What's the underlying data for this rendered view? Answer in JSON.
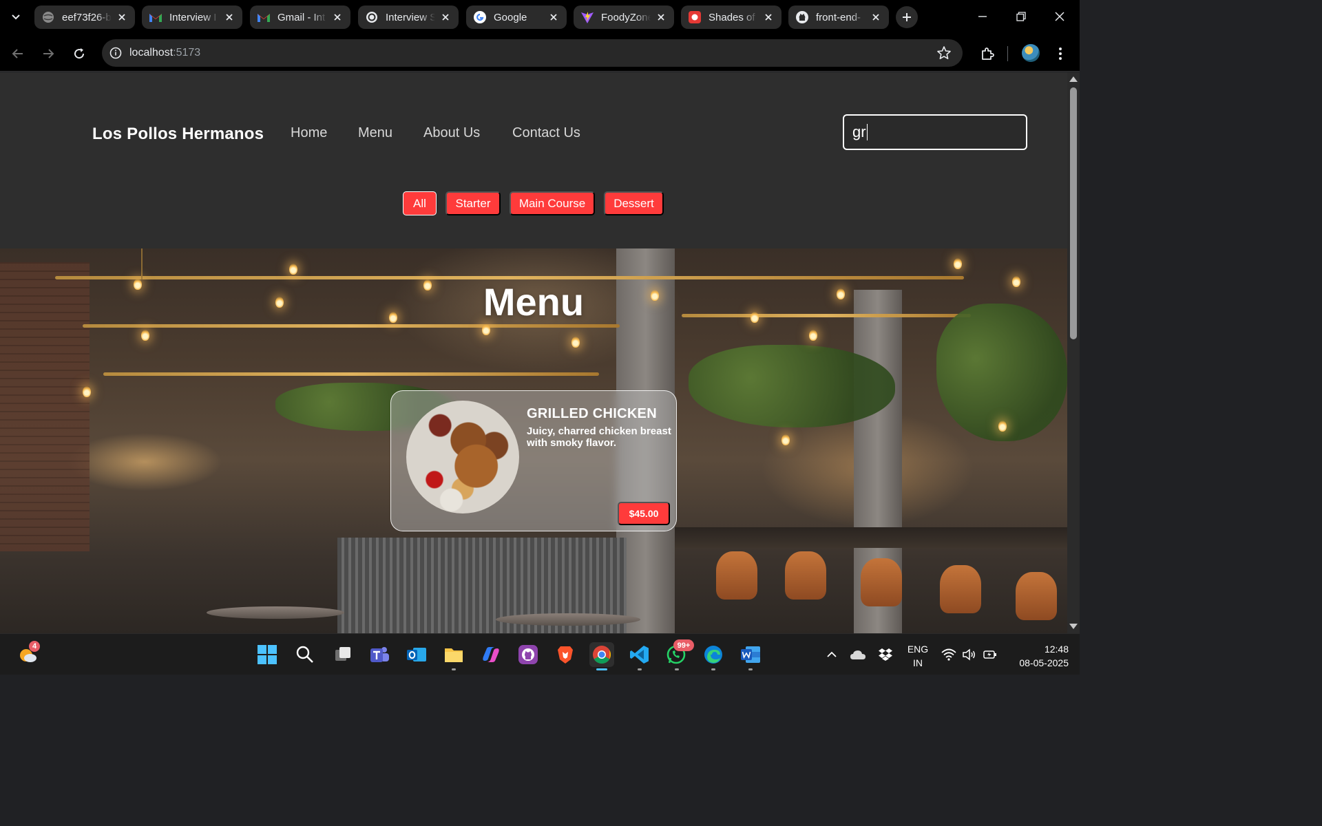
{
  "browser": {
    "tabs": [
      {
        "label": "eef73f26-b",
        "icon": "globe-icon"
      },
      {
        "label": "Interview I",
        "icon": "gmail-icon"
      },
      {
        "label": "Gmail - Int",
        "icon": "gmail-icon"
      },
      {
        "label": "Interview S",
        "icon": "openai-icon"
      },
      {
        "label": "Google",
        "icon": "google-icon"
      },
      {
        "label": "FoodyZone",
        "icon": "vite-icon"
      },
      {
        "label": "Shades of",
        "icon": "red-app-icon"
      },
      {
        "label": "front-end-",
        "icon": "github-icon"
      }
    ],
    "url_host": "localhost",
    "url_port": ":5173"
  },
  "site": {
    "brand": "Los Pollos Hermanos",
    "nav": [
      "Home",
      "Menu",
      "About Us",
      "Contact Us"
    ],
    "search_value": "gr",
    "filters": [
      "All",
      "Starter",
      "Main Course",
      "Dessert"
    ],
    "active_filter": "All",
    "accent_color": "#ff3b3b"
  },
  "hero": {
    "title": "Menu",
    "card": {
      "name": "GRILLED CHICKEN",
      "description": "Juicy, charred chicken breast with smoky flavor.",
      "price": "$45.00"
    }
  },
  "taskbar": {
    "weather_badge": "4",
    "whatsapp_badge": "99+",
    "lang_line1": "ENG",
    "lang_line2": "IN",
    "time": "12:48",
    "date": "08-05-2025"
  }
}
